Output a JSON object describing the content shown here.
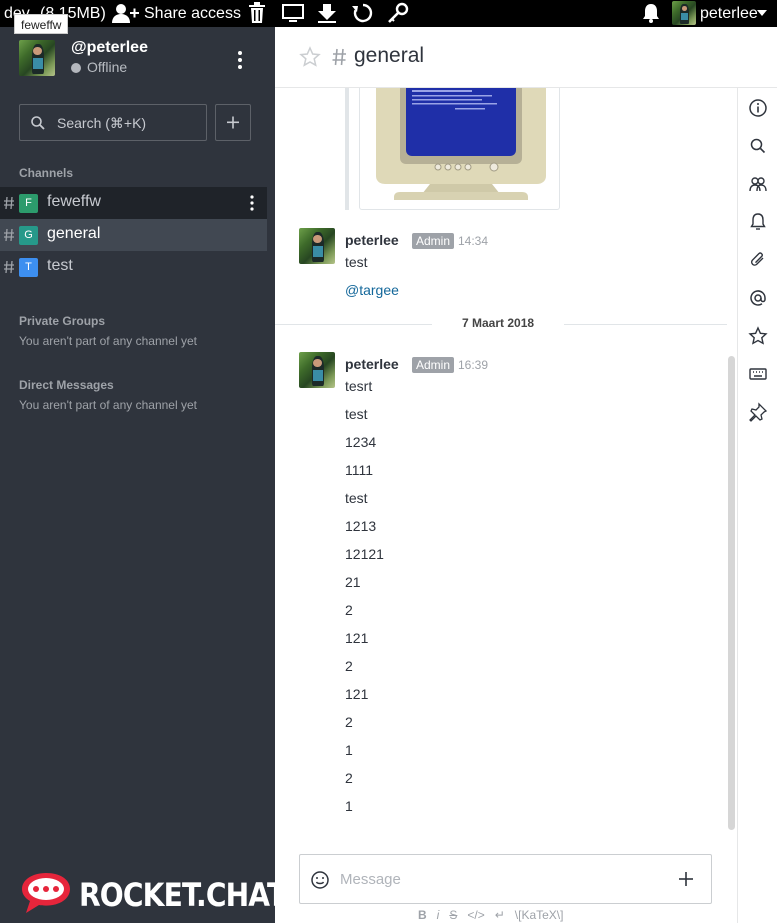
{
  "topbar": {
    "app_label": "dev",
    "memory": "(8.15MB)",
    "share_access": "Share access",
    "username": "peterlee"
  },
  "tooltip": "feweffw",
  "user": {
    "handle": "@peterlee",
    "status": "Offline"
  },
  "search": {
    "label": "Search (⌘+K)"
  },
  "sidebar": {
    "channels_title": "Channels",
    "channels": [
      {
        "name": "feweffw",
        "badge": "F",
        "color": "#2c9b6c"
      },
      {
        "name": "general",
        "badge": "G",
        "color": "#26998a"
      },
      {
        "name": "test",
        "badge": "T",
        "color": "#3d8ff0"
      }
    ],
    "private_title": "Private Groups",
    "private_empty": "You aren't part of any channel yet",
    "direct_title": "Direct Messages",
    "direct_empty": "You aren't part of any channel yet",
    "logo": "ROCKET.CHAT"
  },
  "room": {
    "title": "general"
  },
  "messages": {
    "first": {
      "author": "peterlee",
      "role": "Admin",
      "time": "14:34",
      "lines": [
        "test"
      ],
      "mention": "@targee"
    },
    "day_separator": "7 Maart 2018",
    "second": {
      "author": "peterlee",
      "role": "Admin",
      "time": "16:39",
      "lines": [
        "tesrt",
        "test",
        "1234",
        "1111",
        "test",
        "1213",
        "12121",
        "21",
        "2",
        "121",
        "2",
        "121",
        "2",
        "1",
        "2",
        "1"
      ]
    }
  },
  "composer": {
    "placeholder": "Message"
  },
  "format_bar": {
    "bold": "B",
    "italic": "i",
    "strike": "S",
    "code": "</>",
    "enter": "↵",
    "katex": "\\[KaTeX\\]"
  },
  "colors": {
    "sidebar": "#2f343d",
    "active_channel": "#414852",
    "mention": "#13679a",
    "role_badge": "#9ea2a8"
  },
  "icons": {
    "topbar": [
      "person-plus-icon",
      "trash-icon",
      "monitor-icon",
      "download-icon",
      "refresh-icon",
      "key-icon",
      "bell-icon",
      "chevron-down-icon"
    ],
    "right_bar": [
      "info-icon",
      "search-icon",
      "members-icon",
      "bell-icon",
      "attachment-icon",
      "mention-icon",
      "star-icon",
      "keyboard-icon",
      "pin-icon"
    ]
  }
}
